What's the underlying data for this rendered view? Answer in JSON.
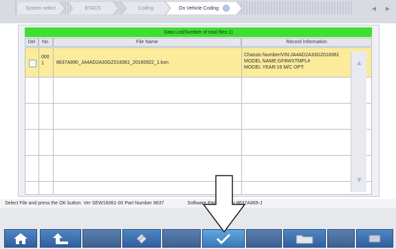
{
  "tabs": [
    {
      "label": "System select"
    },
    {
      "label": "ETACS"
    },
    {
      "label": "Coding"
    },
    {
      "label": "On Vehicle Coding"
    }
  ],
  "nav": {
    "prev": "◀",
    "next": "▶"
  },
  "table": {
    "title": "Data List(Number of total files:1)",
    "columns": {
      "del": "Del",
      "no": "No.",
      "file_name": "File Name",
      "record_info": "Record Information"
    },
    "rows": [
      {
        "no_line1": "000",
        "no_line2": "1",
        "file_name": "8637A890_JA4AD2A33GZ018361_20160922_1.kon",
        "record_line1": "Chassis Number/VIN:JA4AD2A33GZ018361",
        "record_line2": "MODEL NAME:GF8WXTMPL#",
        "record_line3": "MODEL YEAR:16  M/C    OPT:"
      }
    ]
  },
  "status": {
    "left": "Select File and press the OK button. Ver SEW16061-00 Part Number 8637",
    "right": "Software Part Number 8637A869-J"
  },
  "colors": {
    "header_green": "#3ede32",
    "selected_row": "#fbeb9b",
    "button_blue": "#2f5f9e"
  },
  "toolbar": {
    "home_icon": "home-icon",
    "back_icon": "back-icon",
    "erase_icon": "eraser-icon",
    "ok_icon": "checkmark-icon",
    "folder_icon": "folder-icon",
    "cart_icon": "cart-icon"
  }
}
